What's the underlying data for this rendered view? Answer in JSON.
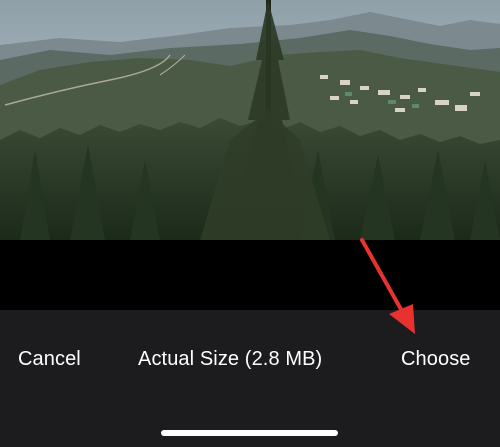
{
  "photo": {
    "icon": "landscape-photo-preview"
  },
  "toolbar": {
    "cancel_label": "Cancel",
    "size_label": "Actual Size (2.8 MB)",
    "choose_label": "Choose"
  },
  "annotation": {
    "icon": "red-arrow-pointer",
    "color": "#e8322f"
  },
  "colors": {
    "toolbar_bg": "#1c1c1e",
    "text": "#ffffff"
  }
}
